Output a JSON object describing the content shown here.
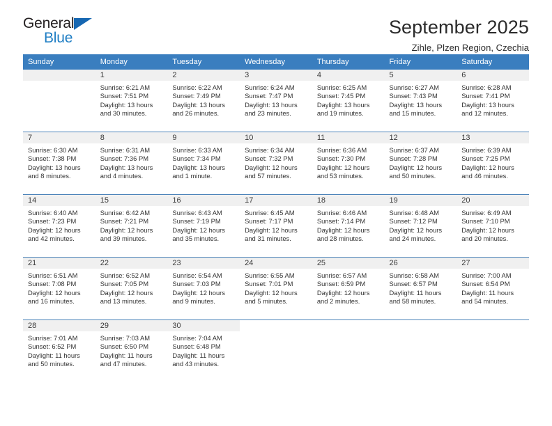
{
  "brand": {
    "name_top": "General",
    "name_bottom": "Blue",
    "triangle_color": "#1667b2",
    "blue_color": "#1f7ec4"
  },
  "header": {
    "month_title": "September 2025",
    "location": "Zihle, Plzen Region, Czechia"
  },
  "theme": {
    "header_row_bg": "#3a7ebf",
    "header_row_text": "#ffffff",
    "daynum_band_bg": "#f0f0f0",
    "week_divider": "#4a82b8"
  },
  "weekday_headers": [
    "Sunday",
    "Monday",
    "Tuesday",
    "Wednesday",
    "Thursday",
    "Friday",
    "Saturday"
  ],
  "weeks": [
    [
      {
        "day": "",
        "empty": true,
        "sunrise": "",
        "sunset": "",
        "daylight_line1": "",
        "daylight_line2": ""
      },
      {
        "day": "1",
        "sunrise": "Sunrise: 6:21 AM",
        "sunset": "Sunset: 7:51 PM",
        "daylight_line1": "Daylight: 13 hours",
        "daylight_line2": "and 30 minutes."
      },
      {
        "day": "2",
        "sunrise": "Sunrise: 6:22 AM",
        "sunset": "Sunset: 7:49 PM",
        "daylight_line1": "Daylight: 13 hours",
        "daylight_line2": "and 26 minutes."
      },
      {
        "day": "3",
        "sunrise": "Sunrise: 6:24 AM",
        "sunset": "Sunset: 7:47 PM",
        "daylight_line1": "Daylight: 13 hours",
        "daylight_line2": "and 23 minutes."
      },
      {
        "day": "4",
        "sunrise": "Sunrise: 6:25 AM",
        "sunset": "Sunset: 7:45 PM",
        "daylight_line1": "Daylight: 13 hours",
        "daylight_line2": "and 19 minutes."
      },
      {
        "day": "5",
        "sunrise": "Sunrise: 6:27 AM",
        "sunset": "Sunset: 7:43 PM",
        "daylight_line1": "Daylight: 13 hours",
        "daylight_line2": "and 15 minutes."
      },
      {
        "day": "6",
        "sunrise": "Sunrise: 6:28 AM",
        "sunset": "Sunset: 7:41 PM",
        "daylight_line1": "Daylight: 13 hours",
        "daylight_line2": "and 12 minutes."
      }
    ],
    [
      {
        "day": "7",
        "sunrise": "Sunrise: 6:30 AM",
        "sunset": "Sunset: 7:38 PM",
        "daylight_line1": "Daylight: 13 hours",
        "daylight_line2": "and 8 minutes."
      },
      {
        "day": "8",
        "sunrise": "Sunrise: 6:31 AM",
        "sunset": "Sunset: 7:36 PM",
        "daylight_line1": "Daylight: 13 hours",
        "daylight_line2": "and 4 minutes."
      },
      {
        "day": "9",
        "sunrise": "Sunrise: 6:33 AM",
        "sunset": "Sunset: 7:34 PM",
        "daylight_line1": "Daylight: 13 hours",
        "daylight_line2": "and 1 minute."
      },
      {
        "day": "10",
        "sunrise": "Sunrise: 6:34 AM",
        "sunset": "Sunset: 7:32 PM",
        "daylight_line1": "Daylight: 12 hours",
        "daylight_line2": "and 57 minutes."
      },
      {
        "day": "11",
        "sunrise": "Sunrise: 6:36 AM",
        "sunset": "Sunset: 7:30 PM",
        "daylight_line1": "Daylight: 12 hours",
        "daylight_line2": "and 53 minutes."
      },
      {
        "day": "12",
        "sunrise": "Sunrise: 6:37 AM",
        "sunset": "Sunset: 7:28 PM",
        "daylight_line1": "Daylight: 12 hours",
        "daylight_line2": "and 50 minutes."
      },
      {
        "day": "13",
        "sunrise": "Sunrise: 6:39 AM",
        "sunset": "Sunset: 7:25 PM",
        "daylight_line1": "Daylight: 12 hours",
        "daylight_line2": "and 46 minutes."
      }
    ],
    [
      {
        "day": "14",
        "sunrise": "Sunrise: 6:40 AM",
        "sunset": "Sunset: 7:23 PM",
        "daylight_line1": "Daylight: 12 hours",
        "daylight_line2": "and 42 minutes."
      },
      {
        "day": "15",
        "sunrise": "Sunrise: 6:42 AM",
        "sunset": "Sunset: 7:21 PM",
        "daylight_line1": "Daylight: 12 hours",
        "daylight_line2": "and 39 minutes."
      },
      {
        "day": "16",
        "sunrise": "Sunrise: 6:43 AM",
        "sunset": "Sunset: 7:19 PM",
        "daylight_line1": "Daylight: 12 hours",
        "daylight_line2": "and 35 minutes."
      },
      {
        "day": "17",
        "sunrise": "Sunrise: 6:45 AM",
        "sunset": "Sunset: 7:17 PM",
        "daylight_line1": "Daylight: 12 hours",
        "daylight_line2": "and 31 minutes."
      },
      {
        "day": "18",
        "sunrise": "Sunrise: 6:46 AM",
        "sunset": "Sunset: 7:14 PM",
        "daylight_line1": "Daylight: 12 hours",
        "daylight_line2": "and 28 minutes."
      },
      {
        "day": "19",
        "sunrise": "Sunrise: 6:48 AM",
        "sunset": "Sunset: 7:12 PM",
        "daylight_line1": "Daylight: 12 hours",
        "daylight_line2": "and 24 minutes."
      },
      {
        "day": "20",
        "sunrise": "Sunrise: 6:49 AM",
        "sunset": "Sunset: 7:10 PM",
        "daylight_line1": "Daylight: 12 hours",
        "daylight_line2": "and 20 minutes."
      }
    ],
    [
      {
        "day": "21",
        "sunrise": "Sunrise: 6:51 AM",
        "sunset": "Sunset: 7:08 PM",
        "daylight_line1": "Daylight: 12 hours",
        "daylight_line2": "and 16 minutes."
      },
      {
        "day": "22",
        "sunrise": "Sunrise: 6:52 AM",
        "sunset": "Sunset: 7:05 PM",
        "daylight_line1": "Daylight: 12 hours",
        "daylight_line2": "and 13 minutes."
      },
      {
        "day": "23",
        "sunrise": "Sunrise: 6:54 AM",
        "sunset": "Sunset: 7:03 PM",
        "daylight_line1": "Daylight: 12 hours",
        "daylight_line2": "and 9 minutes."
      },
      {
        "day": "24",
        "sunrise": "Sunrise: 6:55 AM",
        "sunset": "Sunset: 7:01 PM",
        "daylight_line1": "Daylight: 12 hours",
        "daylight_line2": "and 5 minutes."
      },
      {
        "day": "25",
        "sunrise": "Sunrise: 6:57 AM",
        "sunset": "Sunset: 6:59 PM",
        "daylight_line1": "Daylight: 12 hours",
        "daylight_line2": "and 2 minutes."
      },
      {
        "day": "26",
        "sunrise": "Sunrise: 6:58 AM",
        "sunset": "Sunset: 6:57 PM",
        "daylight_line1": "Daylight: 11 hours",
        "daylight_line2": "and 58 minutes."
      },
      {
        "day": "27",
        "sunrise": "Sunrise: 7:00 AM",
        "sunset": "Sunset: 6:54 PM",
        "daylight_line1": "Daylight: 11 hours",
        "daylight_line2": "and 54 minutes."
      }
    ],
    [
      {
        "day": "28",
        "sunrise": "Sunrise: 7:01 AM",
        "sunset": "Sunset: 6:52 PM",
        "daylight_line1": "Daylight: 11 hours",
        "daylight_line2": "and 50 minutes."
      },
      {
        "day": "29",
        "sunrise": "Sunrise: 7:03 AM",
        "sunset": "Sunset: 6:50 PM",
        "daylight_line1": "Daylight: 11 hours",
        "daylight_line2": "and 47 minutes."
      },
      {
        "day": "30",
        "sunrise": "Sunrise: 7:04 AM",
        "sunset": "Sunset: 6:48 PM",
        "daylight_line1": "Daylight: 11 hours",
        "daylight_line2": "and 43 minutes."
      },
      {
        "day": "",
        "empty": true,
        "blank": true,
        "sunrise": "",
        "sunset": "",
        "daylight_line1": "",
        "daylight_line2": ""
      },
      {
        "day": "",
        "empty": true,
        "blank": true,
        "sunrise": "",
        "sunset": "",
        "daylight_line1": "",
        "daylight_line2": ""
      },
      {
        "day": "",
        "empty": true,
        "blank": true,
        "sunrise": "",
        "sunset": "",
        "daylight_line1": "",
        "daylight_line2": ""
      },
      {
        "day": "",
        "empty": true,
        "blank": true,
        "sunrise": "",
        "sunset": "",
        "daylight_line1": "",
        "daylight_line2": ""
      }
    ]
  ]
}
